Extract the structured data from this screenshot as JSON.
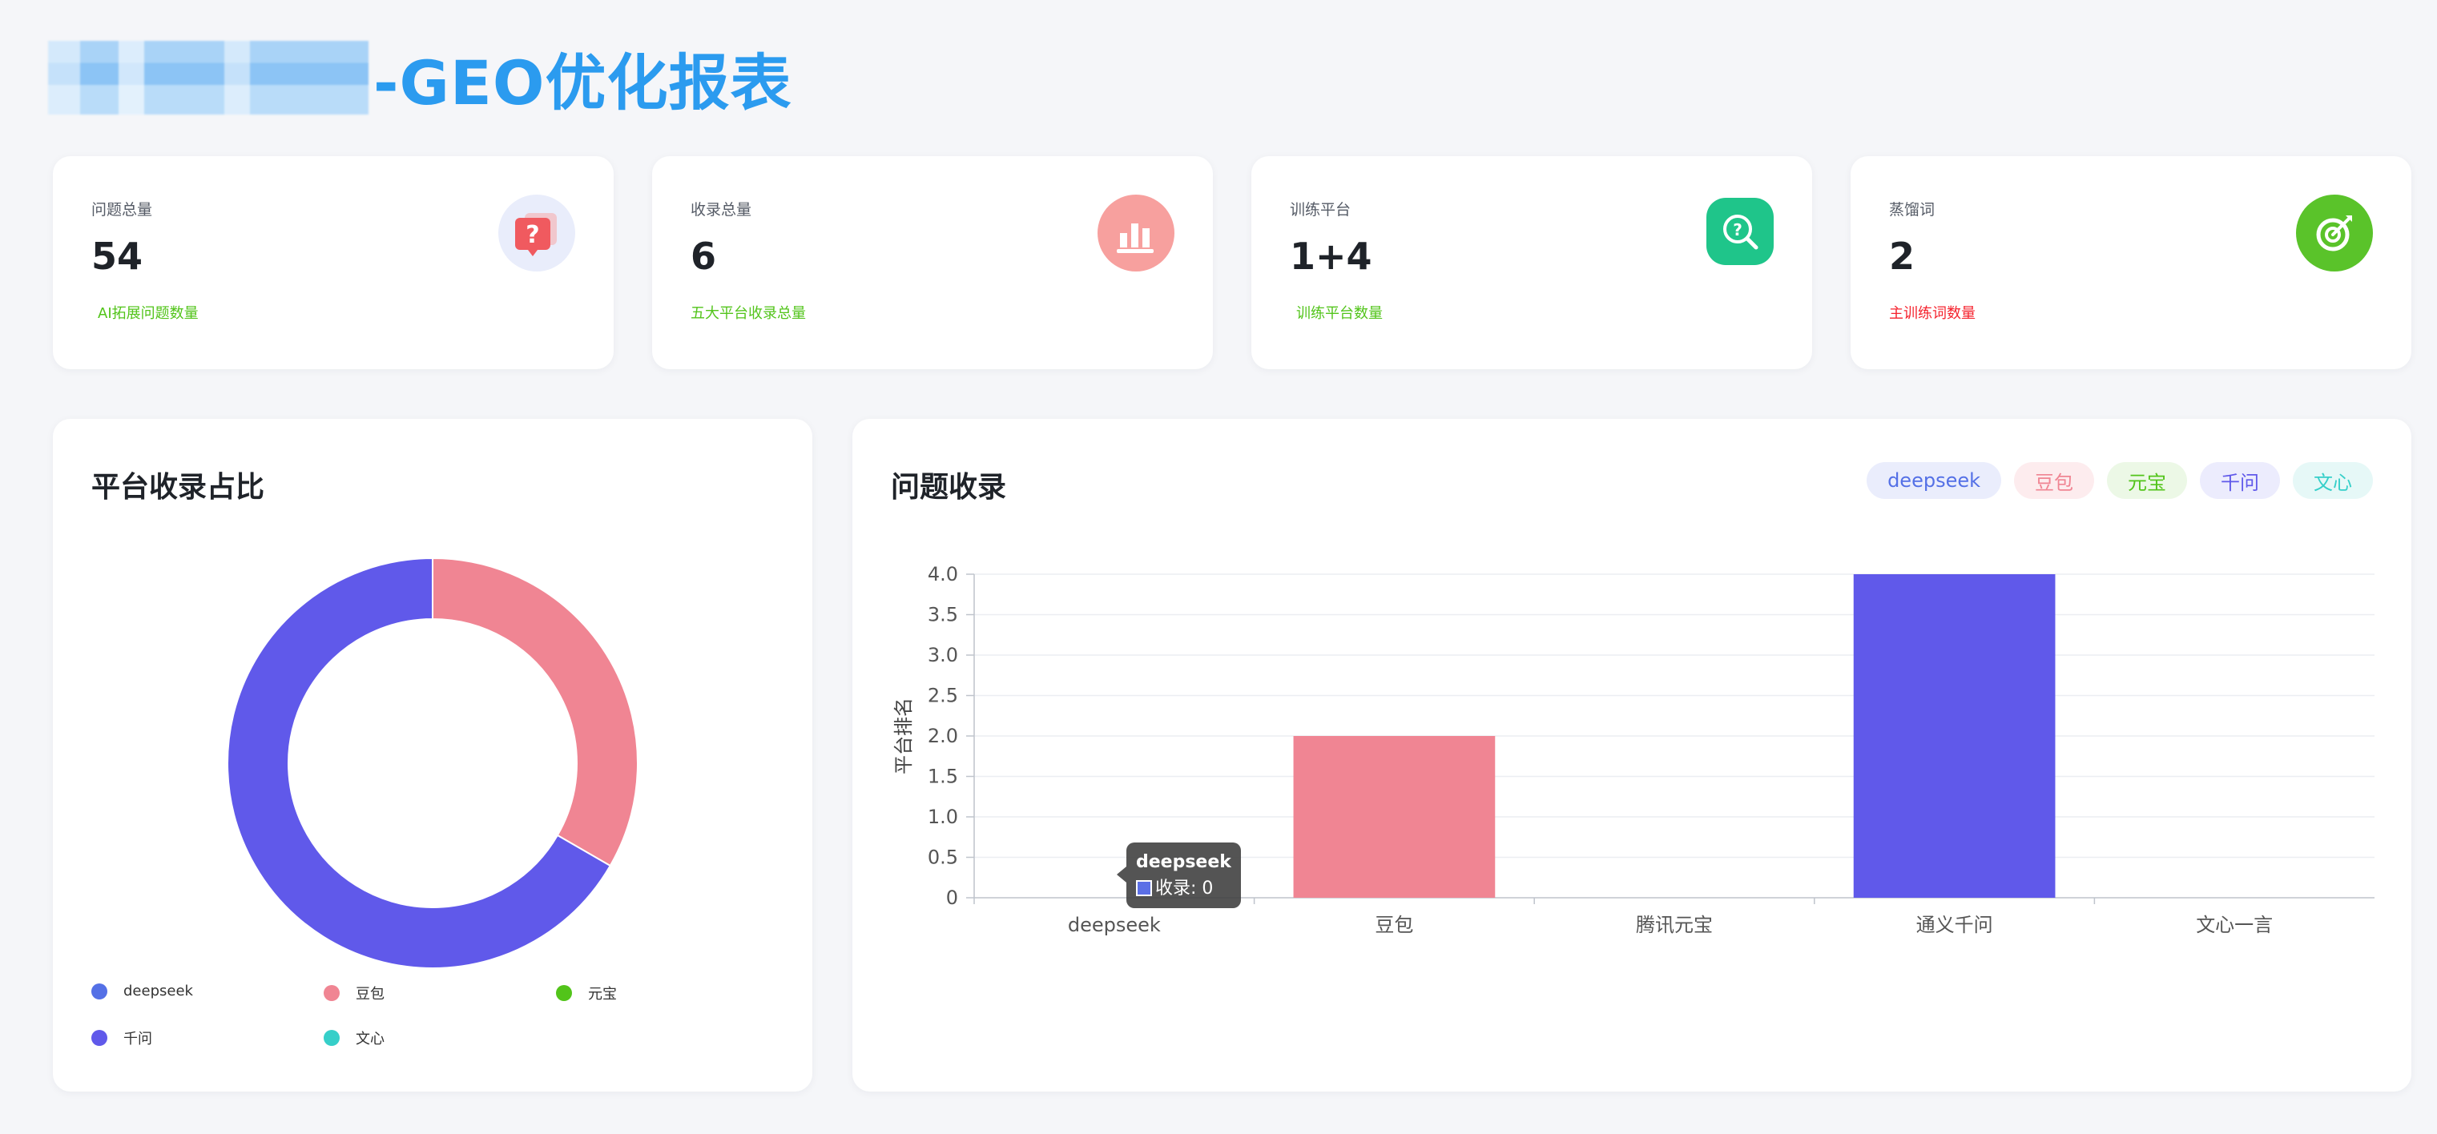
{
  "header": {
    "title_suffix": "-GEO优化报表"
  },
  "stats": [
    {
      "label": "问题总量",
      "value": "54",
      "sub": "AI拓展问题数量",
      "sub_color": "#52c41a",
      "icon": "question-bubble-icon",
      "icon_bg": "#e9edfb"
    },
    {
      "label": "收录总量",
      "value": "6",
      "sub": "五大平台收录总量",
      "sub_color": "#52c41a",
      "icon": "bar-chart-icon",
      "icon_bg": "#f7a09e"
    },
    {
      "label": "训练平台",
      "value": "1+4",
      "sub": "训练平台数量",
      "sub_color": "#52c41a",
      "icon": "search-question-icon",
      "icon_bg": "#1fc58a"
    },
    {
      "label": "蒸馏词",
      "value": "2",
      "sub": "主训练词数量",
      "sub_color": "#f5222d",
      "icon": "target-icon",
      "icon_bg": "#5ac32a"
    }
  ],
  "pie": {
    "title": "平台收录占比",
    "legend": [
      {
        "label": "deepseek",
        "color": "#5470e6"
      },
      {
        "label": "豆包",
        "color": "#f08593"
      },
      {
        "label": "元宝",
        "color": "#52c41a"
      },
      {
        "label": "千问",
        "color": "#6059ea"
      },
      {
        "label": "文心",
        "color": "#36cfc9"
      }
    ]
  },
  "bar": {
    "title": "问题收录",
    "chips": [
      {
        "label": "deepseek",
        "bg": "#eaedfc",
        "color": "#5470e6"
      },
      {
        "label": "豆包",
        "bg": "#fdecee",
        "color": "#f08593"
      },
      {
        "label": "元宝",
        "bg": "#ecf8e6",
        "color": "#52c41a"
      },
      {
        "label": "千问",
        "bg": "#ececfd",
        "color": "#6059ea"
      },
      {
        "label": "文心",
        "bg": "#e6f8f7",
        "color": "#36cfc9"
      }
    ],
    "tooltip": {
      "title": "deepseek",
      "text": "收录: 0"
    }
  },
  "chart_data": [
    {
      "type": "pie",
      "title": "平台收录占比",
      "categories": [
        "deepseek",
        "豆包",
        "元宝",
        "千问",
        "文心"
      ],
      "values": [
        0,
        2,
        0,
        4,
        0
      ],
      "colors": [
        "#5470e6",
        "#f08593",
        "#52c41a",
        "#6059ea",
        "#36cfc9"
      ],
      "donut": true,
      "legend": "bottom"
    },
    {
      "type": "bar",
      "title": "问题收录",
      "categories": [
        "deepseek",
        "豆包",
        "腾讯元宝",
        "通义千问",
        "文心一言"
      ],
      "values": [
        0,
        2,
        0,
        4,
        0
      ],
      "colors": [
        "#5470e6",
        "#f08593",
        "#52c41a",
        "#6059ea",
        "#36cfc9"
      ],
      "ylabel": "平台排名",
      "ylim": [
        0,
        4
      ],
      "yticks": [
        "0",
        "0.5",
        "1.0",
        "1.5",
        "2.0",
        "2.5",
        "3.0",
        "3.5",
        "4.0"
      ],
      "grid": true
    }
  ]
}
